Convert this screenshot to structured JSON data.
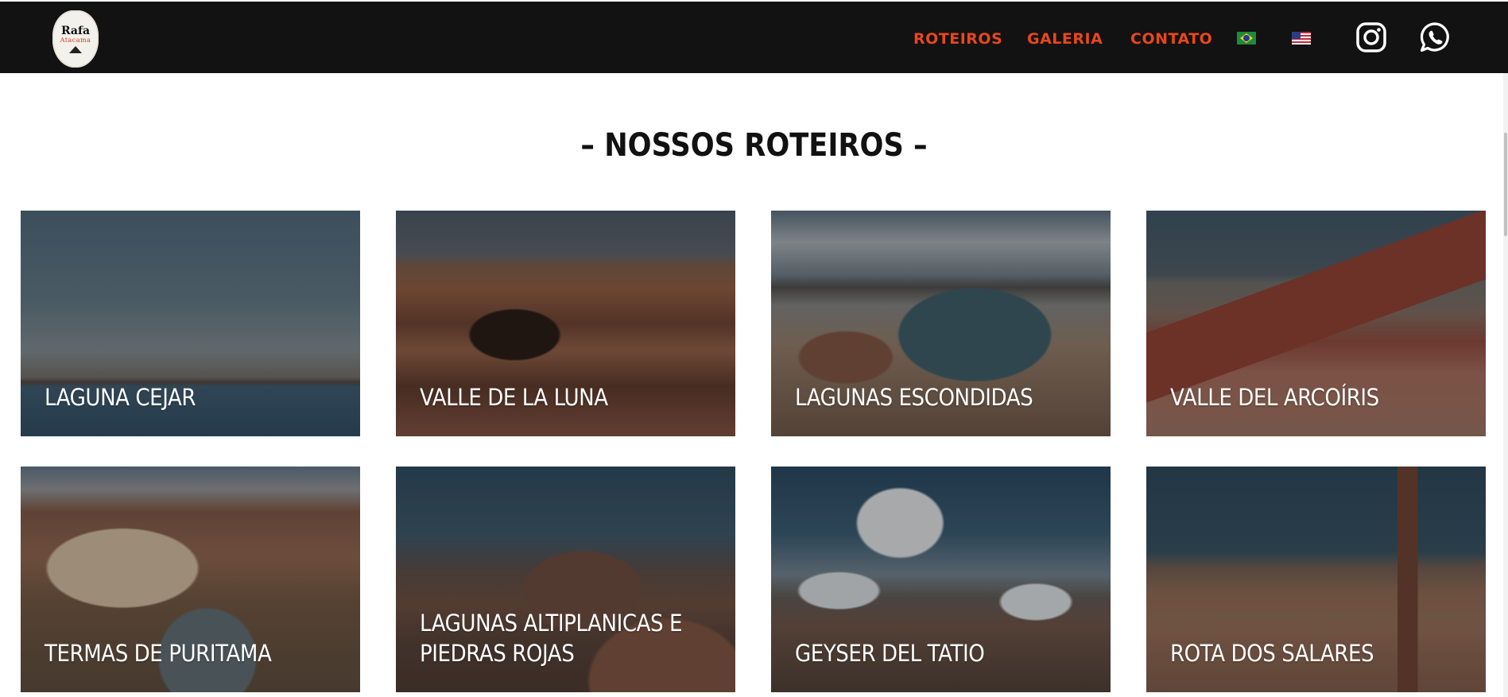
{
  "header": {
    "logo": {
      "line1": "Rafa",
      "line2": "Atacama"
    },
    "nav": [
      {
        "label": "ROTEIROS"
      },
      {
        "label": "GALERIA"
      },
      {
        "label": "CONTATO"
      }
    ],
    "languages": [
      {
        "name": "brazil-flag-icon"
      },
      {
        "name": "us-flag-icon"
      }
    ],
    "social": [
      {
        "name": "instagram-icon"
      },
      {
        "name": "whatsapp-icon"
      }
    ],
    "accent_color": "#e8471b",
    "background_color": "#121212"
  },
  "main": {
    "title": "– NOSSOS ROTEIROS –",
    "tours": [
      {
        "label": "LAGUNA CEJAR"
      },
      {
        "label": "VALLE DE LA LUNA"
      },
      {
        "label": "LAGUNAS ESCONDIDAS"
      },
      {
        "label": "VALLE DEL ARCOÍRIS"
      },
      {
        "label": "TERMAS DE PURITAMA"
      },
      {
        "label": "LAGUNAS ALTIPLANICAS E PIEDRAS ROJAS"
      },
      {
        "label": "GEYSER DEL TATIO"
      },
      {
        "label": "ROTA DOS SALARES"
      }
    ]
  }
}
